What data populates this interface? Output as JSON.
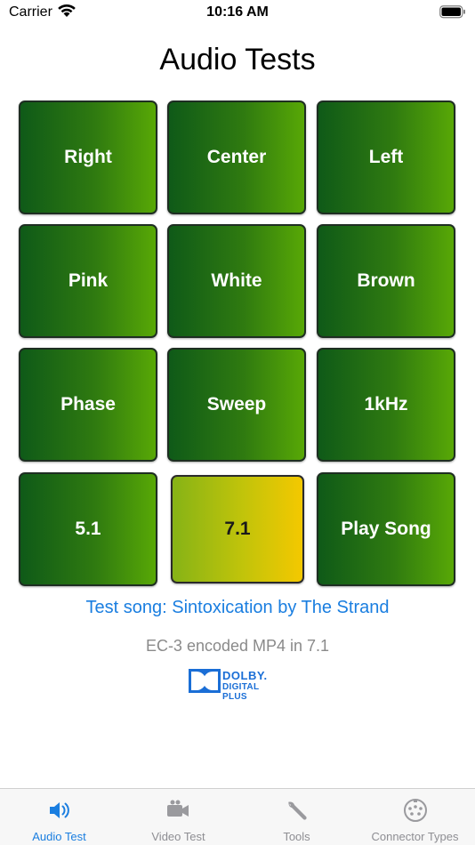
{
  "status_bar": {
    "carrier": "Carrier",
    "time": "10:16 AM"
  },
  "page_title": "Audio Tests",
  "tiles": [
    {
      "label": "Right"
    },
    {
      "label": "Center"
    },
    {
      "label": "Left"
    },
    {
      "label": "Pink"
    },
    {
      "label": "White"
    },
    {
      "label": "Brown"
    },
    {
      "label": "Phase"
    },
    {
      "label": "Sweep"
    },
    {
      "label": "1kHz"
    },
    {
      "label": "5.1"
    },
    {
      "label": "7.1",
      "selected": true
    },
    {
      "label": "Play Song"
    }
  ],
  "song_link": "Test song: Sintoxication by The Strand",
  "format_note": "EC-3 encoded MP4 in 7.1",
  "dolby_logo": {
    "word": "DOLBY.",
    "sub": "DIGITAL PLUS"
  },
  "tab_bar": {
    "tabs": [
      {
        "label": "Audio Test",
        "icon": "speaker-icon",
        "selected": true
      },
      {
        "label": "Video Test",
        "icon": "video-camera-icon",
        "selected": false
      },
      {
        "label": "Tools",
        "icon": "wrench-icon",
        "selected": false
      },
      {
        "label": "Connector Types",
        "icon": "connector-icon",
        "selected": false
      }
    ]
  },
  "colors": {
    "accent": "#1a7ee0",
    "tile_green_dark": "#0f5a18",
    "tile_green_light": "#58a806",
    "tile_selected_yellow": "#f4c800"
  }
}
